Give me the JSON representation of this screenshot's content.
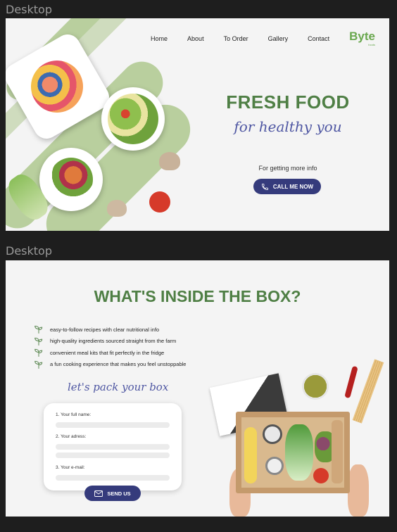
{
  "frames": [
    {
      "label": "Desktop"
    },
    {
      "label": "Desktop"
    }
  ],
  "nav": {
    "items": [
      "Home",
      "About",
      "To Order",
      "Gallery",
      "Contact"
    ],
    "logo": "Byte",
    "logo_sub": "foods"
  },
  "hero": {
    "title": "FRESH FOOD",
    "script": "for healthy  you",
    "info": "For getting more info",
    "cta": "CALL ME NOW"
  },
  "box_section": {
    "title": "WHAT'S INSIDE THE BOX?",
    "features": [
      "easy-to-follow recipes with clear nutritional info",
      "high-quality ingredients sourced straight from the farm",
      "convenient meal kits that fit perfectly in the fridge",
      "a fun cooking experience that makes you feel unstoppable"
    ],
    "script": "let's pack your box",
    "form": {
      "name_label": "1. Your full name:",
      "address_label": "2. Your adress:",
      "email_label": "3. Your e-mail:"
    },
    "submit": "SEND US"
  },
  "colors": {
    "accent_green": "#4f7f45",
    "logo_green": "#6aa84f",
    "stripe_green": "#b9cf9e",
    "button_navy": "#353b7c",
    "script_blue": "#4e56a2"
  },
  "icons": {
    "phone": "phone-icon",
    "mail": "envelope-icon",
    "feature": "sprout-icon"
  }
}
